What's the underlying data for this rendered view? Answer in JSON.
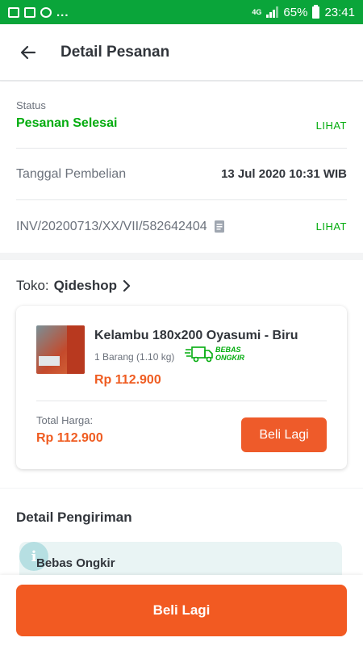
{
  "status_bar": {
    "notification_dots": "...",
    "network": "4G",
    "battery": "65%",
    "time": "23:41"
  },
  "header": {
    "title": "Detail Pesanan"
  },
  "order": {
    "status_label": "Status",
    "status_value": "Pesanan Selesai",
    "lihat_label": "LIHAT",
    "purchase_date_label": "Tanggal Pembelian",
    "purchase_date_value": "13 Jul 2020 10:31 WIB",
    "invoice": "INV/20200713/XX/VII/582642404",
    "invoice_lihat_label": "LIHAT"
  },
  "shop": {
    "prefix": "Toko:",
    "name": "Qideshop"
  },
  "product": {
    "name": "Kelambu 180x200 Oyasumi - Biru",
    "quantity": "1 Barang (1.10 kg)",
    "badge_line1": "BEBAS",
    "badge_line2": "ONGKIR",
    "price": "Rp 112.900",
    "total_label": "Total Harga:",
    "total_value": "Rp 112.900",
    "buy_again_label": "Beli Lagi"
  },
  "shipping": {
    "title": "Detail Pengiriman",
    "info_icon_letter": "i",
    "info_text": "Bebas Ongkir"
  },
  "footer": {
    "buy_again_label": "Beli Lagi"
  },
  "colors": {
    "status_bar": "#0aa53a",
    "accent_green": "#03ac0e",
    "accent_orange": "#f25a22"
  }
}
